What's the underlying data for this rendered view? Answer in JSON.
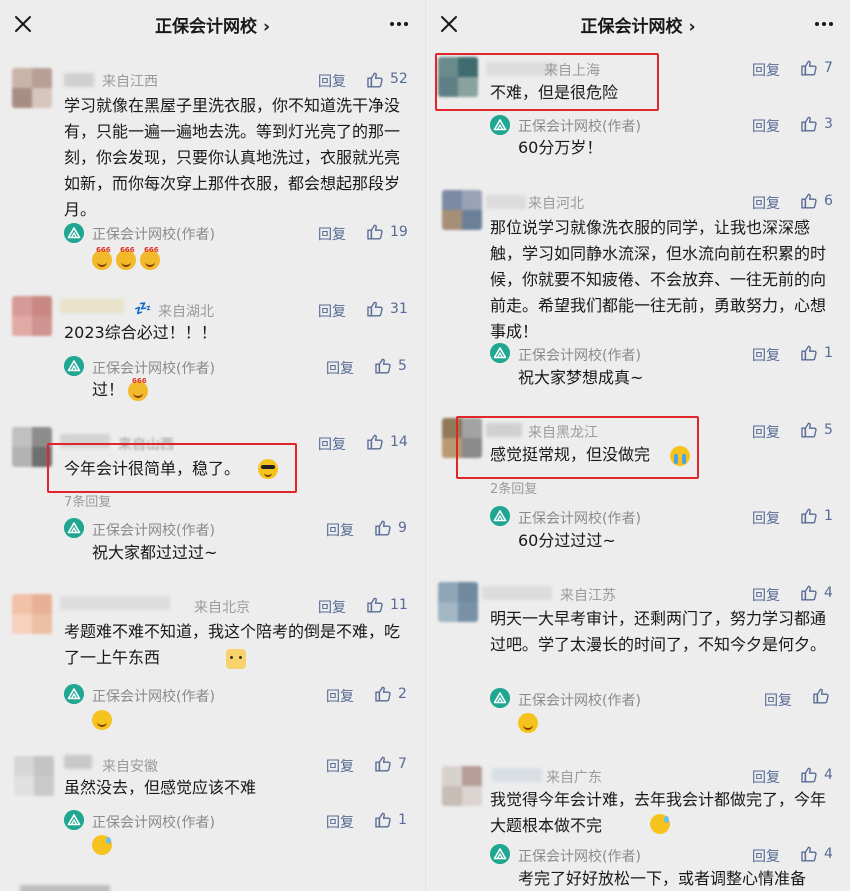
{
  "left": {
    "title": "正保会计网校",
    "c1": {
      "loc": "来自江西",
      "reply": "回复",
      "likes": "52",
      "text": "学习就像在黑屋子里洗衣服，你不知道洗干净没有，只能一遍一遍地去洗。等到灯光亮了的那一刻，你会发现，只要你认真地洗过，衣服就光亮如新，而你每次穿上那件衣服，都会想起那段岁月。",
      "author": "正保会计网校(作者)",
      "a_reply": "回复",
      "a_likes": "19"
    },
    "c2": {
      "loc": "来自湖北",
      "reply": "回复",
      "likes": "31",
      "text": "2023综合必过！！！",
      "author": "正保会计网校(作者)",
      "a_reply": "回复",
      "a_likes": "5",
      "a_text": "过！"
    },
    "c3": {
      "loc": "来自山西",
      "reply": "回复",
      "likes": "14",
      "text": "今年会计很简单，稳了。",
      "more": "7条回复",
      "author": "正保会计网校(作者)",
      "a_reply": "回复",
      "a_likes": "9",
      "a_text": "祝大家都过过过~"
    },
    "c4": {
      "loc": "来自北京",
      "reply": "回复",
      "likes": "11",
      "text": "考题难不难不知道，我这个陪考的倒是不难，吃了一上午东西",
      "author": "正保会计网校(作者)",
      "a_reply": "回复",
      "a_likes": "2"
    },
    "c5": {
      "loc": "来自安徽",
      "reply": "回复",
      "likes": "7",
      "text": "虽然没去，但感觉应该不难",
      "author": "正保会计网校(作者)",
      "a_reply": "回复",
      "a_likes": "1"
    }
  },
  "right": {
    "title": "正保会计网校",
    "c1": {
      "loc": "来自上海",
      "reply": "回复",
      "likes": "7",
      "text": "不难，但是很危险",
      "author": "正保会计网校(作者)",
      "a_reply": "回复",
      "a_likes": "3",
      "a_text": "60分万岁！"
    },
    "c2": {
      "loc": "来自河北",
      "reply": "回复",
      "likes": "6",
      "text": "那位说学习就像洗衣服的同学，让我也深深感触，学习如同静水流深，但水流向前在积累的时候，你就要不知疲倦、不会放弃、一往无前的向前走。希望我们都能一往无前，勇敢努力，心想事成！",
      "author": "正保会计网校(作者)",
      "a_reply": "回复",
      "a_likes": "1",
      "a_text": "祝大家梦想成真~"
    },
    "c3": {
      "loc": "来自黑龙江",
      "reply": "回复",
      "likes": "5",
      "text": "感觉挺常规，但没做完",
      "more": "2条回复",
      "author": "正保会计网校(作者)",
      "a_reply": "回复",
      "a_likes": "1",
      "a_text": "60分过过过~"
    },
    "c4": {
      "loc": "来自江苏",
      "reply": "回复",
      "likes": "4",
      "text": "明天一大早考审计，还剩两门了，努力学习都通过吧。学了太漫长的时间了，不知今夕是何夕。",
      "author": "正保会计网校(作者)",
      "a_reply": "回复"
    },
    "c5": {
      "loc": "来自广东",
      "reply": "回复",
      "likes": "4",
      "text": "我觉得今年会计难，去年我会计都做完了，今年大题根本做不完",
      "author": "正保会计网校(作者)",
      "a_reply": "回复",
      "a_likes": "4",
      "a_text": "考完了好好放松一下，或者调整心情准备"
    }
  },
  "colors": {
    "link": "#576b95",
    "highlight": "#e0262b",
    "brand": "#1fa792"
  }
}
